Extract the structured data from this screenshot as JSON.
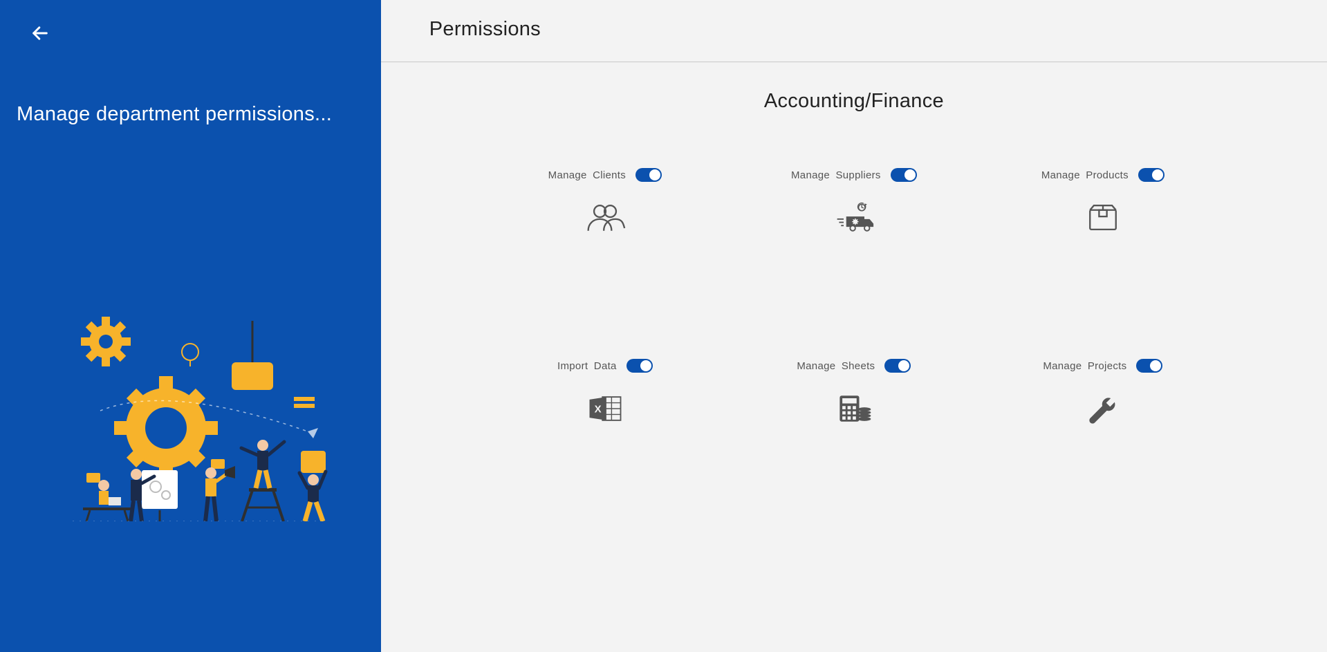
{
  "sidebar": {
    "title": "Manage department permissions..."
  },
  "header": {
    "title": "Permissions"
  },
  "section": {
    "title": "Accounting/Finance"
  },
  "permissions": [
    {
      "key": "clients",
      "label": "Manage Clients",
      "on": true,
      "icon": "people-icon"
    },
    {
      "key": "suppliers",
      "label": "Manage Suppliers",
      "on": true,
      "icon": "delivery-icon"
    },
    {
      "key": "products",
      "label": "Manage Products",
      "on": true,
      "icon": "box-icon"
    },
    {
      "key": "import",
      "label": "Import Data",
      "on": true,
      "icon": "excel-icon"
    },
    {
      "key": "sheets",
      "label": "Manage Sheets",
      "on": true,
      "icon": "calculator-icon"
    },
    {
      "key": "projects",
      "label": "Manage Projects",
      "on": true,
      "icon": "wrench-icon"
    }
  ],
  "colors": {
    "accent": "#0b51ae"
  }
}
